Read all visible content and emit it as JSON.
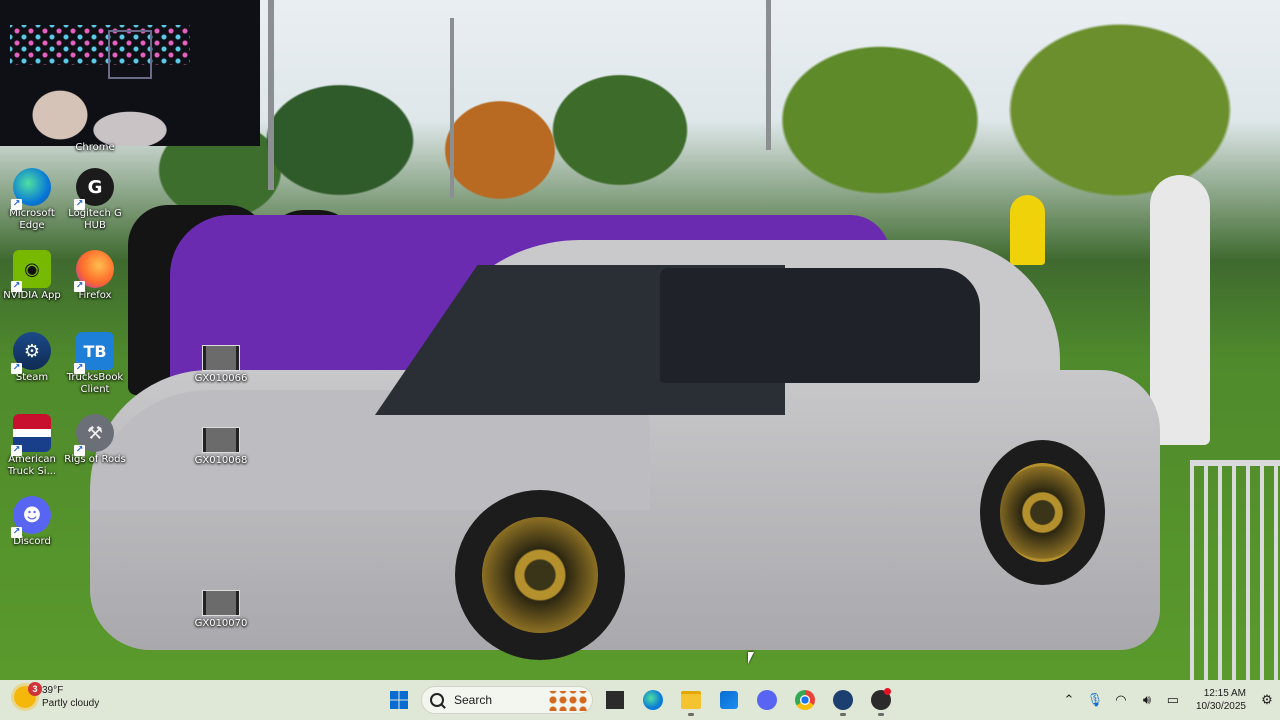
{
  "desktop": {
    "icons": [
      {
        "id": "chrome",
        "label": "Chrome",
        "icon": "chrome-icon"
      },
      {
        "id": "edge",
        "label": "Microsoft Edge",
        "icon": "edge-icon"
      },
      {
        "id": "logitech",
        "label": "Logitech G HUB",
        "icon": "logitech-icon"
      },
      {
        "id": "nvidia",
        "label": "NVIDIA App",
        "icon": "nvidia-icon"
      },
      {
        "id": "firefox",
        "label": "Firefox",
        "icon": "firefox-icon"
      },
      {
        "id": "steam",
        "label": "Steam",
        "icon": "steam-icon"
      },
      {
        "id": "trucksbook",
        "label": "TrucksBook Client",
        "icon": "trucksbook-icon",
        "glyph": "TB"
      },
      {
        "id": "gx066",
        "label": "GX010066",
        "icon": "video-file-icon"
      },
      {
        "id": "ats",
        "label": "American Truck Si...",
        "icon": "american-truck-simulator-icon"
      },
      {
        "id": "rigs",
        "label": "Rigs of Rods",
        "icon": "rigs-of-rods-icon"
      },
      {
        "id": "gx068",
        "label": "GX010068",
        "icon": "video-file-icon"
      },
      {
        "id": "discord",
        "label": "Discord",
        "icon": "discord-icon"
      },
      {
        "id": "gx070",
        "label": "GX010070",
        "icon": "video-file-icon"
      }
    ]
  },
  "taskbar": {
    "weather": {
      "badge": "3",
      "temp": "39°F",
      "condition": "Partly cloudy"
    },
    "start_icon": "windows-start-icon",
    "search_label": "Search",
    "apps": [
      {
        "name": "task-view-icon"
      },
      {
        "name": "edge-icon"
      },
      {
        "name": "file-explorer-icon"
      },
      {
        "name": "microsoft-store-icon"
      },
      {
        "name": "discord-icon"
      },
      {
        "name": "chrome-icon"
      },
      {
        "name": "steam-icon"
      },
      {
        "name": "obs-icon"
      }
    ],
    "clock": {
      "time": "12:15 AM",
      "date": "10/30/2025"
    }
  },
  "colors": {
    "taskbar_bg": "#dfe7d6",
    "accent": "#0078d4",
    "notification": "#d13438"
  }
}
